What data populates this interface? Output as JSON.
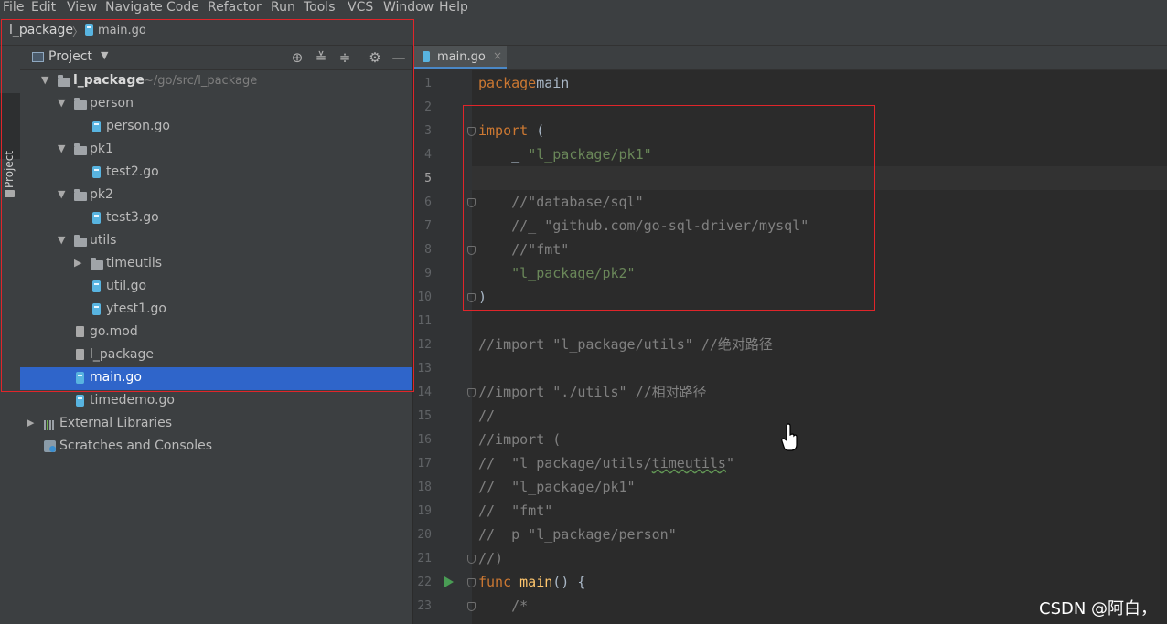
{
  "menu": [
    "File",
    "Edit",
    "View",
    "Navigate",
    "Code",
    "Refactor",
    "Run",
    "Tools",
    "VCS",
    "Window",
    "Help"
  ],
  "breadcrumb": {
    "root": "l_package",
    "separator": "〉",
    "file": "main.go"
  },
  "tool_strip": {
    "label": "Project"
  },
  "project_panel": {
    "title": "Project",
    "tools": [
      "locate-icon",
      "expand-all-icon",
      "collapse-all-icon",
      "gear-icon",
      "minimize-icon"
    ],
    "tree": [
      {
        "label": "l_package",
        "hint": "~/go/src/l_package",
        "icon": "folder-icon",
        "arrow": "down",
        "bold": true
      },
      {
        "label": "person",
        "icon": "folder-icon",
        "arrow": "down"
      },
      {
        "label": "person.go",
        "icon": "go-file-icon"
      },
      {
        "label": "pk1",
        "icon": "folder-icon",
        "arrow": "down"
      },
      {
        "label": "test2.go",
        "icon": "go-file-icon"
      },
      {
        "label": "pk2",
        "icon": "folder-icon",
        "arrow": "down"
      },
      {
        "label": "test3.go",
        "icon": "go-file-icon"
      },
      {
        "label": "utils",
        "icon": "folder-icon",
        "arrow": "down"
      },
      {
        "label": "timeutils",
        "icon": "folder-icon",
        "arrow": "right"
      },
      {
        "label": "util.go",
        "icon": "go-file-icon"
      },
      {
        "label": "ytest1.go",
        "icon": "go-file-icon"
      },
      {
        "label": "go.mod",
        "icon": "go-mod-icon"
      },
      {
        "label": "l_package",
        "icon": "executable-icon"
      },
      {
        "label": "main.go",
        "icon": "go-file-icon",
        "selected": true
      },
      {
        "label": "timedemo.go",
        "icon": "go-file-icon"
      },
      {
        "label": "External Libraries",
        "icon": "library-icon",
        "arrow": "right"
      },
      {
        "label": "Scratches and Consoles",
        "icon": "scratches-icon"
      }
    ]
  },
  "editor_tab": {
    "label": "main.go",
    "close": "×"
  },
  "editor": {
    "current_line": 5,
    "lines": [
      {
        "n": "1",
        "parts": [
          [
            "kw",
            "package"
          ],
          [
            "",
            "main"
          ]
        ]
      },
      {
        "n": "2",
        "parts": []
      },
      {
        "n": "3",
        "parts": [
          [
            "kw",
            "import"
          ],
          [
            "",
            " ("
          ]
        ],
        "fold": true
      },
      {
        "n": "4",
        "parts": [
          [
            "",
            "    _ "
          ],
          [
            "str",
            "\"l_package/pk1\""
          ]
        ]
      },
      {
        "n": "5",
        "parts": []
      },
      {
        "n": "6",
        "parts": [
          [
            "cmt",
            "    //\"database/sql\""
          ]
        ],
        "fold": true
      },
      {
        "n": "7",
        "parts": [
          [
            "cmt",
            "    //_ \"github.com/go-sql-driver/mysql\""
          ]
        ]
      },
      {
        "n": "8",
        "parts": [
          [
            "cmt",
            "    //\"fmt\""
          ]
        ],
        "fold": true
      },
      {
        "n": "9",
        "parts": [
          [
            "str",
            "    \"l_package/pk2\""
          ]
        ]
      },
      {
        "n": "10",
        "parts": [
          [
            "",
            ")"
          ]
        ],
        "fold": true
      },
      {
        "n": "11",
        "parts": []
      },
      {
        "n": "12",
        "parts": [
          [
            "cmt",
            "//import \"l_package/utils\" //绝对路径"
          ]
        ]
      },
      {
        "n": "13",
        "parts": []
      },
      {
        "n": "14",
        "parts": [
          [
            "cmt",
            "//import \"./utils\" //相对路径"
          ]
        ],
        "fold": true
      },
      {
        "n": "15",
        "parts": [
          [
            "cmt",
            "//"
          ]
        ]
      },
      {
        "n": "16",
        "parts": [
          [
            "cmt",
            "//import ("
          ]
        ]
      },
      {
        "n": "17",
        "parts": [
          [
            "cmt",
            "//  \"l_package/utils/"
          ],
          [
            "cmt squig",
            "timeutils"
          ],
          [
            "cmt",
            "\""
          ]
        ]
      },
      {
        "n": "18",
        "parts": [
          [
            "cmt",
            "//  \"l_package/pk1\""
          ]
        ]
      },
      {
        "n": "19",
        "parts": [
          [
            "cmt",
            "//  \"fmt\""
          ]
        ]
      },
      {
        "n": "20",
        "parts": [
          [
            "cmt",
            "//  p \"l_package/person\""
          ]
        ]
      },
      {
        "n": "21",
        "parts": [
          [
            "cmt",
            "//)"
          ]
        ],
        "fold": true
      },
      {
        "n": "22",
        "parts": [
          [
            "kw",
            "func"
          ],
          [
            "",
            " "
          ],
          [
            "fn",
            "main"
          ],
          [
            "",
            "() {"
          ]
        ],
        "fold": true,
        "run": true
      },
      {
        "n": "23",
        "parts": [
          [
            "cmt",
            "    /*"
          ]
        ],
        "fold": true
      }
    ]
  },
  "watermark": "CSDN @阿白，",
  "colors": {
    "selection": "#2f65ca",
    "annotation": "#e0252a",
    "keyword": "#cc7832",
    "string": "#6a8759",
    "comment": "#808080"
  }
}
